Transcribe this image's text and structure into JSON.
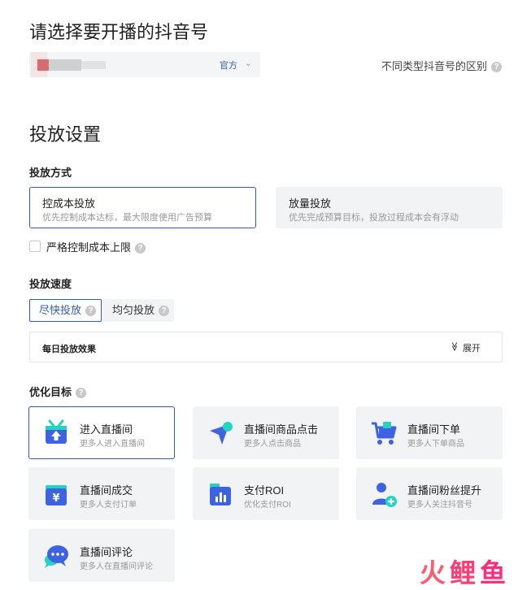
{
  "page_title": "请选择要开播的抖音号",
  "account": {
    "tag": "官方",
    "chevron": "⌄"
  },
  "account_diff_link": "不同类型抖音号的区别",
  "section_title": "投放设置",
  "delivery_method": {
    "label": "投放方式",
    "options": [
      {
        "title": "控成本投放",
        "subtitle": "优先控制成本达标，最大限度使用广告预算"
      },
      {
        "title": "放量投放",
        "subtitle": "优先完成预算目标，投放过程成本会有浮动"
      }
    ],
    "strict_cost": "严格控制成本上限"
  },
  "delivery_speed": {
    "label": "投放速度",
    "options": [
      "尽快投放",
      "均匀投放"
    ]
  },
  "daily_effect": {
    "title": "每日投放效果",
    "expand": "展开",
    "expand_icon": "≫"
  },
  "goal": {
    "label": "优化目标",
    "items": [
      {
        "title": "进入直播间",
        "subtitle": "更多人进入直播间"
      },
      {
        "title": "直播间商品点击",
        "subtitle": "更多人点击商品"
      },
      {
        "title": "直播间下单",
        "subtitle": "更多人下单商品"
      },
      {
        "title": "直播间成交",
        "subtitle": "更多人支付订单"
      },
      {
        "title": "支付ROI",
        "subtitle": "优化支付ROI"
      },
      {
        "title": "直播间粉丝提升",
        "subtitle": "更多人关注抖音号"
      },
      {
        "title": "直播间评论",
        "subtitle": "更多人在直播间评论"
      }
    ]
  },
  "watermark": {
    "part1": "火",
    "part2": "鲤",
    "part3": "鱼"
  },
  "colors": {
    "primary": "#2f5ca8",
    "icon_blue": "#3d63e0",
    "icon_teal": "#23d4c2",
    "card_bg": "#f2f3f5"
  },
  "help_glyph": "?"
}
